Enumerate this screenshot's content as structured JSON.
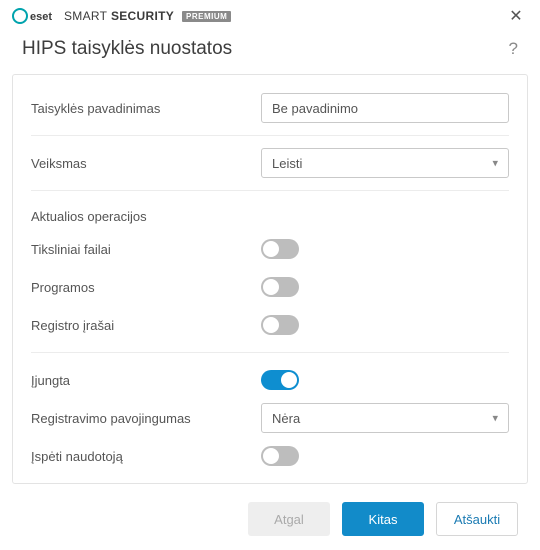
{
  "titlebar": {
    "brand_light": "SMART",
    "brand_bold": "SECURITY",
    "premium": "PREMIUM"
  },
  "header": {
    "title": "HIPS taisyklės nuostatos"
  },
  "form": {
    "rule_name_label": "Taisyklės pavadinimas",
    "rule_name_value": "Be pavadinimo",
    "action_label": "Veiksmas",
    "action_value": "Leisti",
    "ops_section": "Aktualios operacijos",
    "target_files_label": "Tiksliniai failai",
    "target_files_on": false,
    "programs_label": "Programos",
    "programs_on": false,
    "registry_label": "Registro įrašai",
    "registry_on": false,
    "enabled_label": "Įjungta",
    "enabled_on": true,
    "severity_label": "Registravimo pavojingumas",
    "severity_value": "Nėra",
    "notify_label": "Įspėti naudotoją",
    "notify_on": false
  },
  "footer": {
    "back": "Atgal",
    "next": "Kitas",
    "cancel": "Atšaukti"
  }
}
